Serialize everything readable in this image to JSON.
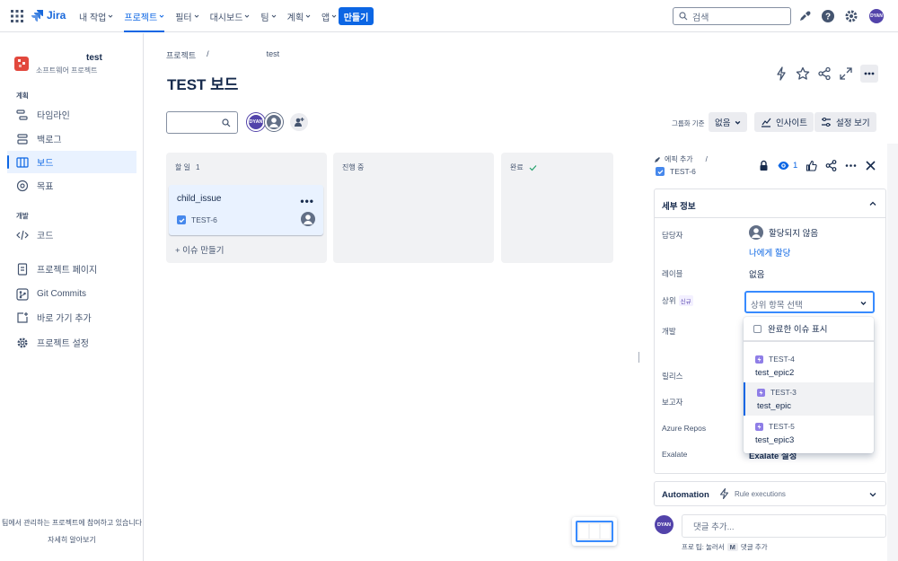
{
  "topnav": {
    "app_name": "Jira",
    "menu": [
      {
        "label": "내 작업",
        "active": false
      },
      {
        "label": "프로젝트",
        "active": true
      },
      {
        "label": "필터",
        "active": false
      },
      {
        "label": "대시보드",
        "active": false
      },
      {
        "label": "팀",
        "active": false
      },
      {
        "label": "계획",
        "active": false
      },
      {
        "label": "앱",
        "active": false
      }
    ],
    "create_label": "만들기",
    "search_placeholder": "검색",
    "avatar_initials": "DYAN"
  },
  "sidebar": {
    "project_name": "test",
    "project_type": "소프트웨어 프로젝트",
    "planning_label": "계획",
    "dev_label": "개발",
    "items": {
      "timeline": "타임라인",
      "backlog": "백로그",
      "board": "보드",
      "goals": "목표",
      "code": "코드",
      "project_pages": "프로젝트 페이지",
      "git_commits": "Git Commits",
      "add_shortcut": "바로 가기 추가",
      "project_settings": "프로젝트 설정"
    },
    "footer_text": "팀에서 관리하는 프로젝트에 참여하고 있습니다",
    "footer_link": "자세히 알아보기"
  },
  "main": {
    "breadcrumb": [
      "프로젝트",
      "test"
    ],
    "title": "TEST 보드",
    "avatar_initials": "DYAN",
    "group_by_label": "그룹화 기준",
    "group_by_value": "없음",
    "insights_label": "인사이트",
    "view_settings_label": "설정 보기"
  },
  "board": {
    "columns": [
      {
        "title": "할 일",
        "count": "1"
      },
      {
        "title": "진행 중",
        "count": ""
      },
      {
        "title": "완료",
        "count": ""
      }
    ],
    "card": {
      "title": "child_issue",
      "key": "TEST-6"
    },
    "create_issue_label": "+ 이슈 만들기"
  },
  "issue_panel": {
    "add_epic_label": "에픽 추가",
    "issue_key": "TEST-6",
    "watch_count": "1",
    "details_title": "세부 정보",
    "fields": {
      "assignee_label": "담당자",
      "assignee_value": "할당되지 않음",
      "assign_to_me": "나에게 할당",
      "labels_label": "레이블",
      "labels_value": "없음",
      "parent_label": "상위",
      "new_badge": "신규",
      "parent_placeholder": "상위 항목 선택",
      "development_label": "개발",
      "release_label": "릴리스",
      "reporter_label": "보고자",
      "azure_label": "Azure Repos",
      "exalate_label": "Exalate",
      "exalate_value": "Exalate 설정"
    },
    "dropdown": {
      "show_done_label": "완료한 이슈 표시",
      "options": [
        {
          "key": "TEST-4",
          "name": "test_epic2",
          "highlighted": false
        },
        {
          "key": "TEST-3",
          "name": "test_epic",
          "highlighted": true
        },
        {
          "key": "TEST-5",
          "name": "test_epic3",
          "highlighted": false
        }
      ]
    },
    "automation_title": "Automation",
    "rule_executions": "Rule executions",
    "comment_avatar": "DYAN",
    "comment_placeholder": "댓글 추가...",
    "pro_tip_prefix": "프로 팁: 눌러서",
    "pro_tip_key": "M",
    "pro_tip_suffix": "댓글 추가"
  },
  "colors": {
    "brand": "#0C66E4",
    "avatar": "#5243AA",
    "project_icon": "#E2483D",
    "epic": "#8F7EE7"
  }
}
